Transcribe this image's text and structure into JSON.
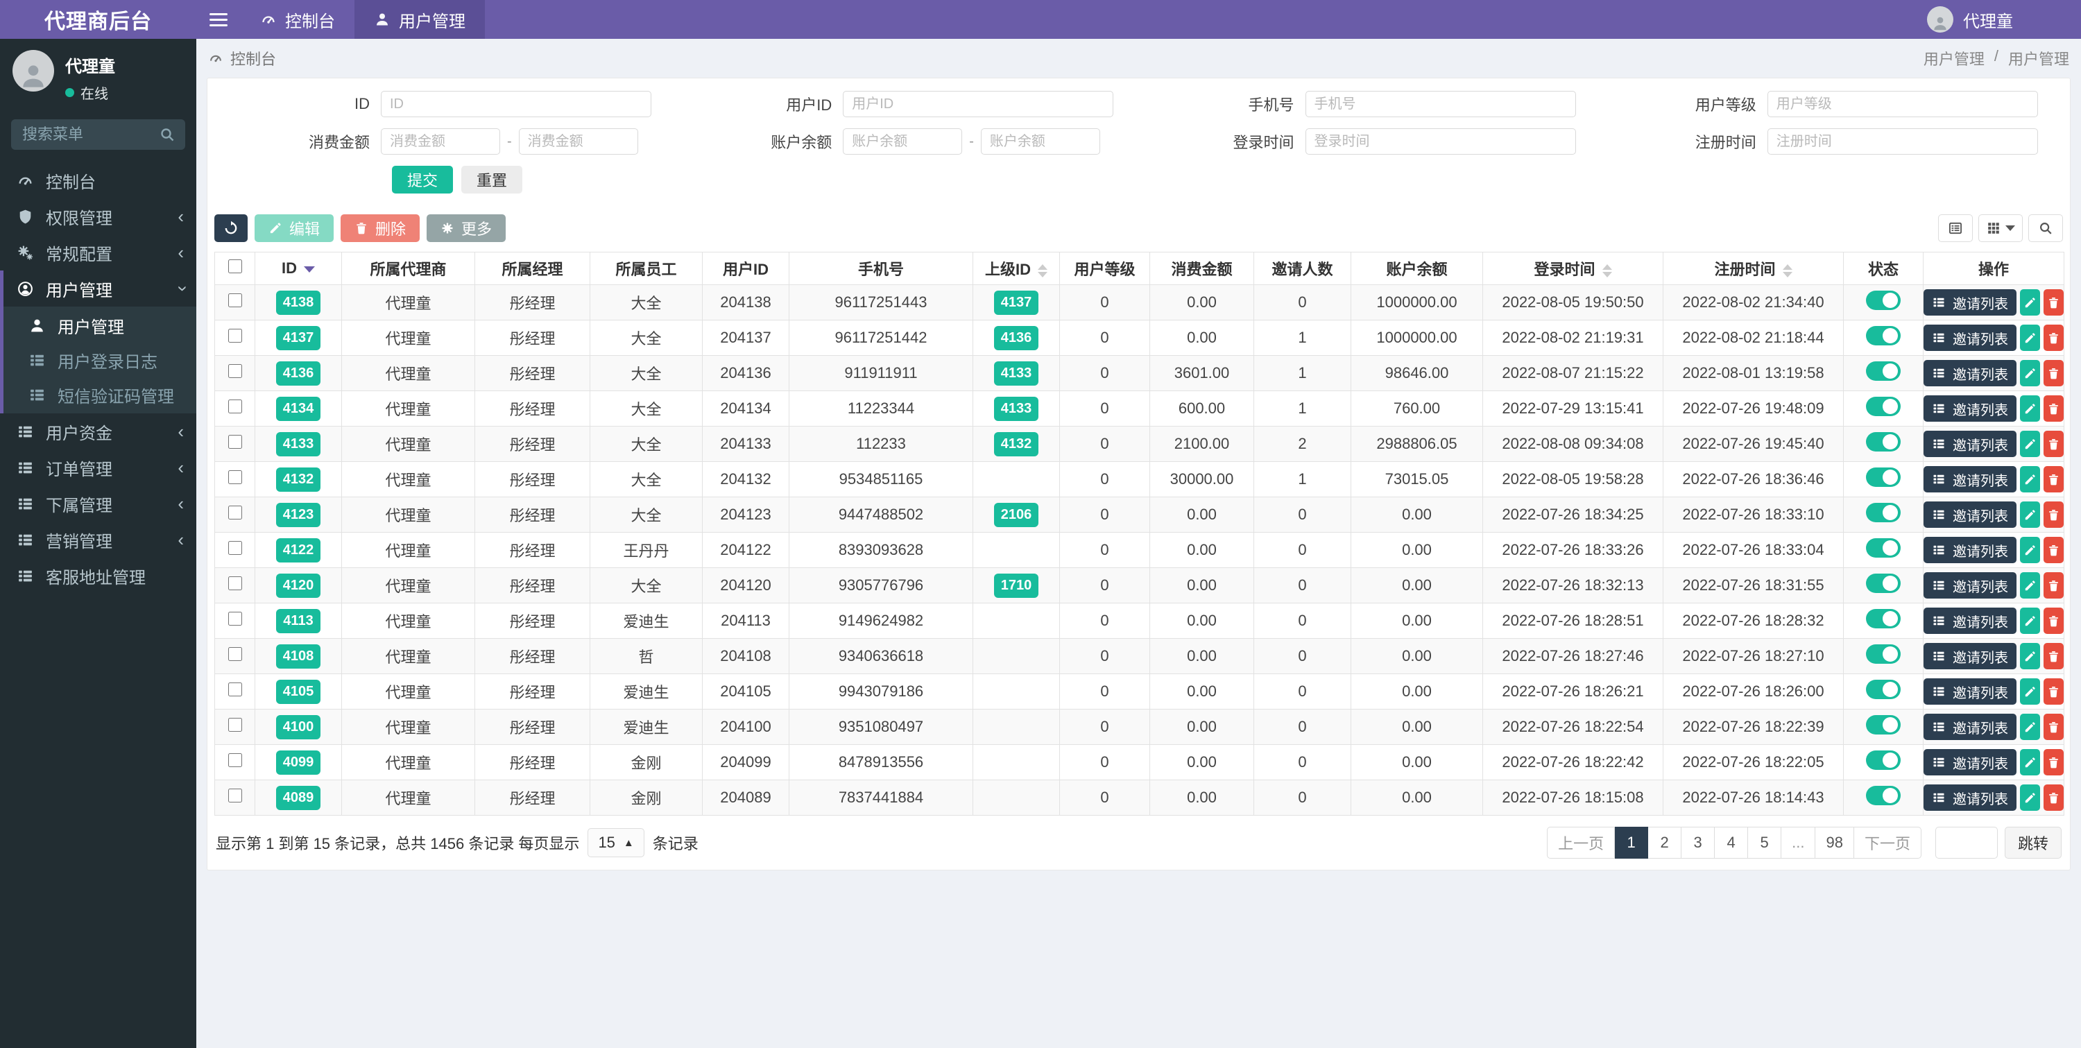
{
  "brand": {
    "title": "代理商后台"
  },
  "navbar": {
    "tabs": [
      {
        "key": "dashboard",
        "label": "控制台"
      },
      {
        "key": "user-mgmt",
        "label": "用户管理",
        "active": true
      }
    ],
    "user_name": "代理童"
  },
  "sidebar": {
    "user": {
      "name": "代理童",
      "status": "在线"
    },
    "search_placeholder": "搜索菜单",
    "items": [
      {
        "key": "dashboard",
        "label": "控制台",
        "icon": "gauge"
      },
      {
        "key": "permission",
        "label": "权限管理",
        "icon": "shield",
        "arrow": "left"
      },
      {
        "key": "config",
        "label": "常规配置",
        "icon": "gears",
        "arrow": "left"
      },
      {
        "key": "user-mgmt",
        "label": "用户管理",
        "icon": "user-circle",
        "arrow": "down",
        "active": true,
        "children": [
          {
            "key": "user-mgmt",
            "label": "用户管理",
            "icon": "person",
            "active": true
          },
          {
            "key": "login-log",
            "label": "用户登录日志",
            "icon": "list"
          },
          {
            "key": "sms-code",
            "label": "短信验证码管理",
            "icon": "list"
          }
        ]
      },
      {
        "key": "funds",
        "label": "用户资金",
        "icon": "list",
        "arrow": "left"
      },
      {
        "key": "orders",
        "label": "订单管理",
        "icon": "list",
        "arrow": "left"
      },
      {
        "key": "subordinates",
        "label": "下属管理",
        "icon": "list",
        "arrow": "left"
      },
      {
        "key": "marketing",
        "label": "营销管理",
        "icon": "list",
        "arrow": "left"
      },
      {
        "key": "service-address",
        "label": "客服地址管理",
        "icon": "list"
      }
    ]
  },
  "breadcrumb": {
    "left": "控制台",
    "right_1": "用户管理",
    "separator": "/",
    "right_2": "用户管理"
  },
  "filters": {
    "rows": [
      [
        {
          "key": "id",
          "label": "ID",
          "placeholder": "ID",
          "type": "single"
        },
        {
          "key": "user-id",
          "label": "用户ID",
          "placeholder": "用户ID",
          "type": "single"
        },
        {
          "key": "phone",
          "label": "手机号",
          "placeholder": "手机号",
          "type": "single"
        },
        {
          "key": "level",
          "label": "用户等级",
          "placeholder": "用户等级",
          "type": "single"
        }
      ],
      [
        {
          "key": "consume",
          "label": "消费金额",
          "placeholder": "消费金额",
          "type": "range"
        },
        {
          "key": "balance",
          "label": "账户余额",
          "placeholder": "账户余额",
          "type": "range"
        },
        {
          "key": "login-time",
          "label": "登录时间",
          "placeholder": "登录时间",
          "type": "single"
        },
        {
          "key": "register-time",
          "label": "注册时间",
          "placeholder": "注册时间",
          "type": "single"
        }
      ]
    ],
    "submit_label": "提交",
    "reset_label": "重置"
  },
  "toolbar": {
    "edit_label": "编辑",
    "delete_label": "删除",
    "more_label": "更多"
  },
  "table": {
    "columns": [
      {
        "label": "ID",
        "sort": "desc"
      },
      {
        "label": "所属代理商"
      },
      {
        "label": "所属经理"
      },
      {
        "label": "所属员工"
      },
      {
        "label": "用户ID"
      },
      {
        "label": "手机号"
      },
      {
        "label": "上级ID",
        "sort": "both"
      },
      {
        "label": "用户等级"
      },
      {
        "label": "消费金额"
      },
      {
        "label": "邀请人数"
      },
      {
        "label": "账户余额"
      },
      {
        "label": "登录时间",
        "sort": "both"
      },
      {
        "label": "注册时间",
        "sort": "both"
      },
      {
        "label": "状态"
      },
      {
        "label": "操作"
      }
    ],
    "invite_button_label": "邀请列表",
    "rows": [
      {
        "id": "4138",
        "agent": "代理童",
        "manager": "彤经理",
        "staff": "大全",
        "user_id": "204138",
        "phone": "96117251443",
        "parent_id": "4137",
        "level": "0",
        "consume": "0.00",
        "invites": "0",
        "balance": "1000000.00",
        "login_time": "2022-08-05 19:50:50",
        "register_time": "2022-08-02 21:34:40",
        "status": true
      },
      {
        "id": "4137",
        "agent": "代理童",
        "manager": "彤经理",
        "staff": "大全",
        "user_id": "204137",
        "phone": "96117251442",
        "parent_id": "4136",
        "level": "0",
        "consume": "0.00",
        "invites": "1",
        "balance": "1000000.00",
        "login_time": "2022-08-02 21:19:31",
        "register_time": "2022-08-02 21:18:44",
        "status": true
      },
      {
        "id": "4136",
        "agent": "代理童",
        "manager": "彤经理",
        "staff": "大全",
        "user_id": "204136",
        "phone": "911911911",
        "parent_id": "4133",
        "level": "0",
        "consume": "3601.00",
        "invites": "1",
        "balance": "98646.00",
        "login_time": "2022-08-07 21:15:22",
        "register_time": "2022-08-01 13:19:58",
        "status": true
      },
      {
        "id": "4134",
        "agent": "代理童",
        "manager": "彤经理",
        "staff": "大全",
        "user_id": "204134",
        "phone": "11223344",
        "parent_id": "4133",
        "level": "0",
        "consume": "600.00",
        "invites": "1",
        "balance": "760.00",
        "login_time": "2022-07-29 13:15:41",
        "register_time": "2022-07-26 19:48:09",
        "status": true
      },
      {
        "id": "4133",
        "agent": "代理童",
        "manager": "彤经理",
        "staff": "大全",
        "user_id": "204133",
        "phone": "112233",
        "parent_id": "4132",
        "level": "0",
        "consume": "2100.00",
        "invites": "2",
        "balance": "2988806.05",
        "login_time": "2022-08-08 09:34:08",
        "register_time": "2022-07-26 19:45:40",
        "status": true
      },
      {
        "id": "4132",
        "agent": "代理童",
        "manager": "彤经理",
        "staff": "大全",
        "user_id": "204132",
        "phone": "9534851165",
        "parent_id": "",
        "level": "0",
        "consume": "30000.00",
        "invites": "1",
        "balance": "73015.05",
        "login_time": "2022-08-05 19:58:28",
        "register_time": "2022-07-26 18:36:46",
        "status": true
      },
      {
        "id": "4123",
        "agent": "代理童",
        "manager": "彤经理",
        "staff": "大全",
        "user_id": "204123",
        "phone": "9447488502",
        "parent_id": "2106",
        "level": "0",
        "consume": "0.00",
        "invites": "0",
        "balance": "0.00",
        "login_time": "2022-07-26 18:34:25",
        "register_time": "2022-07-26 18:33:10",
        "status": true
      },
      {
        "id": "4122",
        "agent": "代理童",
        "manager": "彤经理",
        "staff": "王丹丹",
        "user_id": "204122",
        "phone": "8393093628",
        "parent_id": "",
        "level": "0",
        "consume": "0.00",
        "invites": "0",
        "balance": "0.00",
        "login_time": "2022-07-26 18:33:26",
        "register_time": "2022-07-26 18:33:04",
        "status": true
      },
      {
        "id": "4120",
        "agent": "代理童",
        "manager": "彤经理",
        "staff": "大全",
        "user_id": "204120",
        "phone": "9305776796",
        "parent_id": "1710",
        "level": "0",
        "consume": "0.00",
        "invites": "0",
        "balance": "0.00",
        "login_time": "2022-07-26 18:32:13",
        "register_time": "2022-07-26 18:31:55",
        "status": true
      },
      {
        "id": "4113",
        "agent": "代理童",
        "manager": "彤经理",
        "staff": "爱迪生",
        "user_id": "204113",
        "phone": "9149624982",
        "parent_id": "",
        "level": "0",
        "consume": "0.00",
        "invites": "0",
        "balance": "0.00",
        "login_time": "2022-07-26 18:28:51",
        "register_time": "2022-07-26 18:28:32",
        "status": true
      },
      {
        "id": "4108",
        "agent": "代理童",
        "manager": "彤经理",
        "staff": "哲",
        "user_id": "204108",
        "phone": "9340636618",
        "parent_id": "",
        "level": "0",
        "consume": "0.00",
        "invites": "0",
        "balance": "0.00",
        "login_time": "2022-07-26 18:27:46",
        "register_time": "2022-07-26 18:27:10",
        "status": true
      },
      {
        "id": "4105",
        "agent": "代理童",
        "manager": "彤经理",
        "staff": "爱迪生",
        "user_id": "204105",
        "phone": "9943079186",
        "parent_id": "",
        "level": "0",
        "consume": "0.00",
        "invites": "0",
        "balance": "0.00",
        "login_time": "2022-07-26 18:26:21",
        "register_time": "2022-07-26 18:26:00",
        "status": true
      },
      {
        "id": "4100",
        "agent": "代理童",
        "manager": "彤经理",
        "staff": "爱迪生",
        "user_id": "204100",
        "phone": "9351080497",
        "parent_id": "",
        "level": "0",
        "consume": "0.00",
        "invites": "0",
        "balance": "0.00",
        "login_time": "2022-07-26 18:22:54",
        "register_time": "2022-07-26 18:22:39",
        "status": true
      },
      {
        "id": "4099",
        "agent": "代理童",
        "manager": "彤经理",
        "staff": "金刚",
        "user_id": "204099",
        "phone": "8478913556",
        "parent_id": "",
        "level": "0",
        "consume": "0.00",
        "invites": "0",
        "balance": "0.00",
        "login_time": "2022-07-26 18:22:42",
        "register_time": "2022-07-26 18:22:05",
        "status": true
      },
      {
        "id": "4089",
        "agent": "代理童",
        "manager": "彤经理",
        "staff": "金刚",
        "user_id": "204089",
        "phone": "7837441884",
        "parent_id": "",
        "level": "0",
        "consume": "0.00",
        "invites": "0",
        "balance": "0.00",
        "login_time": "2022-07-26 18:15:08",
        "register_time": "2022-07-26 18:14:43",
        "status": true
      }
    ]
  },
  "pagination": {
    "info": "显示第 1 到第 15 条记录，总共 1456 条记录 每页显示",
    "page_size": "15",
    "info_suffix": "条记录",
    "prev": "上一页",
    "next": "下一页",
    "pages": [
      "1",
      "2",
      "3",
      "4",
      "5",
      "...",
      "98"
    ],
    "active_page": "1",
    "jump_label": "跳转"
  },
  "colors": {
    "navbar_purple": "#6a5ca8",
    "sidebar_dark": "#222d32",
    "submenu_dark": "#2c3b41",
    "accent_teal": "#18bc9c",
    "dark_navy": "#2c3e50",
    "danger_red": "#e74c3c",
    "bulk_edit_teal": "#85dac4",
    "bulk_delete_salmon": "#ef8276",
    "more_gray": "#95a5a6",
    "content_bg": "#eef1f6"
  }
}
